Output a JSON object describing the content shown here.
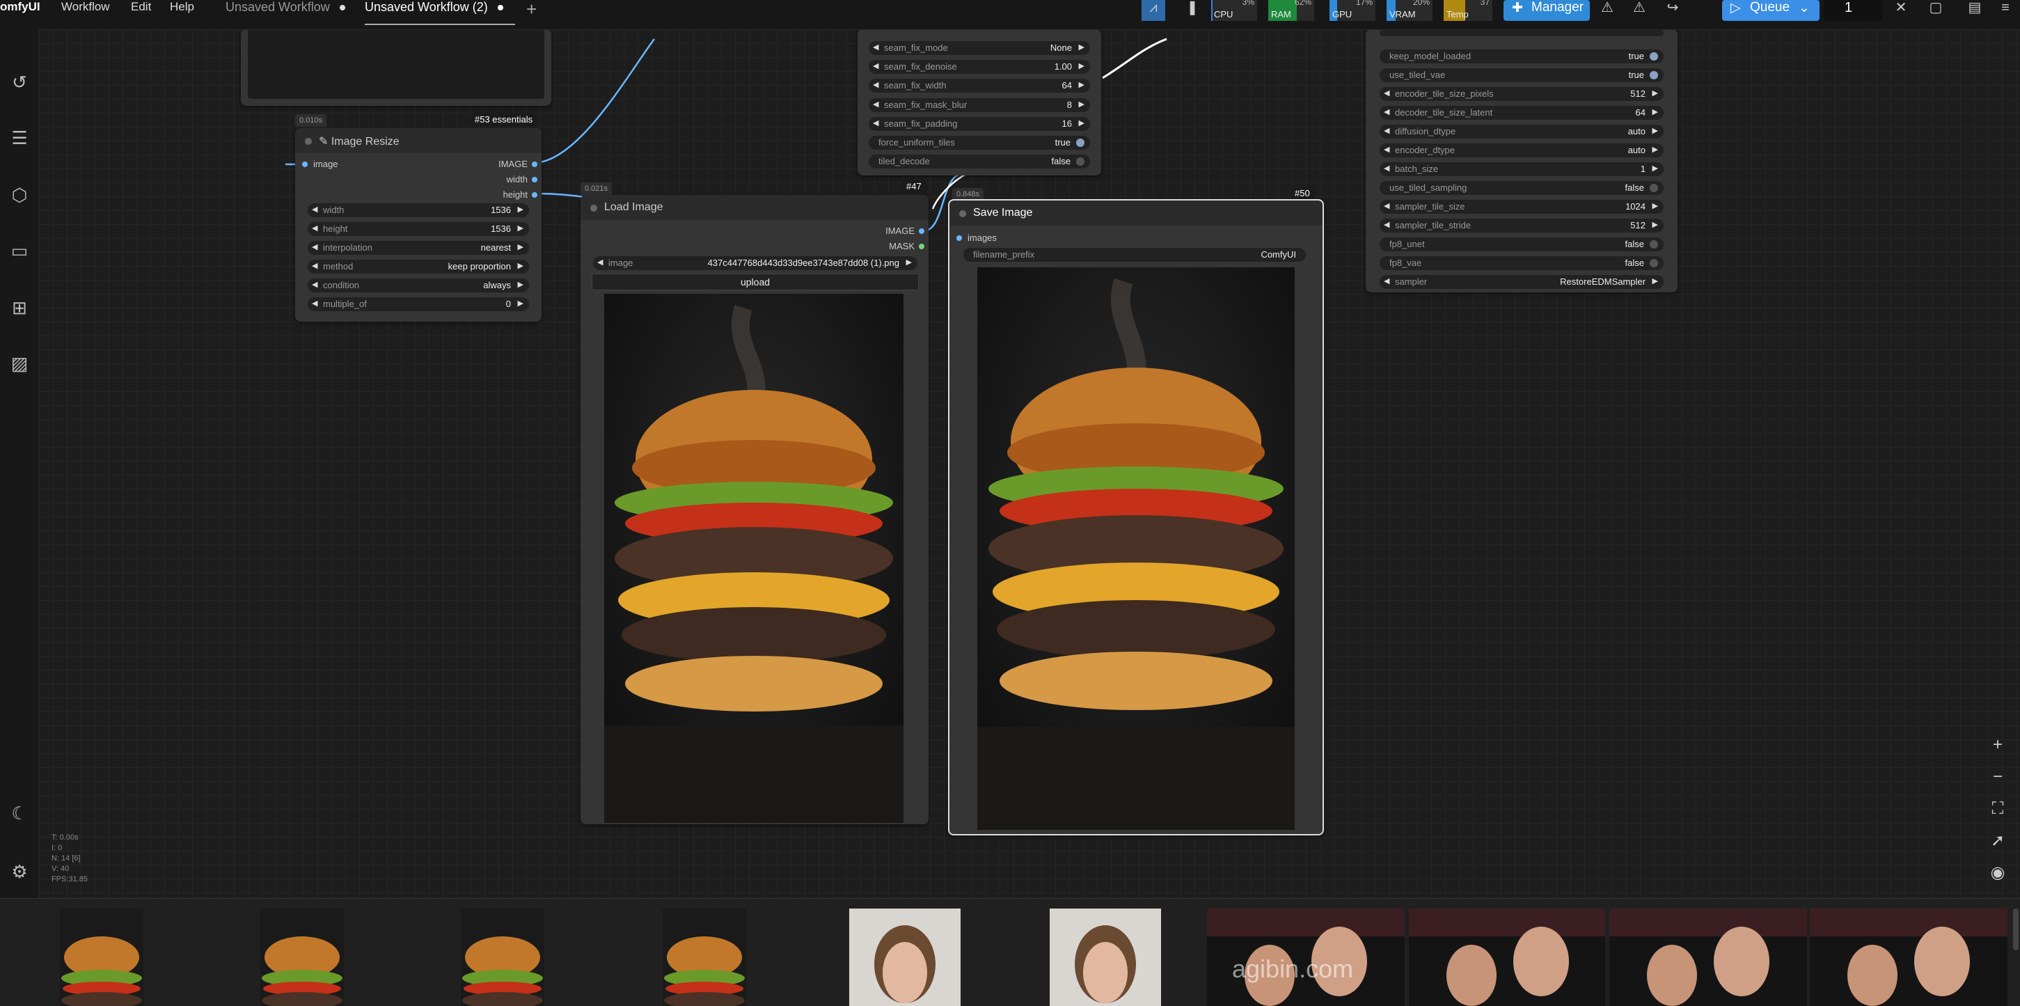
{
  "app": {
    "logo": "omfyUI"
  },
  "menu": [
    "Workflow",
    "Edit",
    "Help"
  ],
  "tabs": [
    {
      "label": "Unsaved Workflow",
      "active": false
    },
    {
      "label": "Unsaved Workflow (2)",
      "active": true
    }
  ],
  "monitor": {
    "cpu": {
      "label": "CPU",
      "value": "3%",
      "color": "#2f8ad8"
    },
    "ram": {
      "label": "RAM",
      "value": "62%",
      "color": "#1e8a3c"
    },
    "gpu": {
      "label": "GPU",
      "value": "17%",
      "color": "#2f8ad8"
    },
    "vram": {
      "label": "VRAM",
      "value": "20%",
      "color": "#2f8ad8"
    },
    "temp": {
      "label": "Temp",
      "value": "37",
      "color": "#b08a10"
    }
  },
  "toolbar": {
    "manager_label": "Manager",
    "queue_label": "Queue",
    "batch_count": "1"
  },
  "nodes": {
    "image_resize": {
      "timing": "0.010s",
      "badge": "#53 essentials",
      "title": "Image Resize",
      "input": "image",
      "outputs": [
        "IMAGE",
        "width",
        "height"
      ],
      "widgets": [
        {
          "label": "width",
          "value": "1536"
        },
        {
          "label": "height",
          "value": "1536"
        },
        {
          "label": "interpolation",
          "value": "nearest"
        },
        {
          "label": "method",
          "value": "keep proportion"
        },
        {
          "label": "condition",
          "value": "always"
        },
        {
          "label": "multiple_of",
          "value": "0"
        }
      ]
    },
    "load_image": {
      "timing": "0.021s",
      "badge": "#47",
      "title": "Load Image",
      "outputs": [
        "IMAGE",
        "MASK"
      ],
      "image_widget": {
        "label": "image",
        "value": "437c447768d443d33d9ee3743e87dd08 (1).png"
      },
      "upload_label": "upload"
    },
    "save_image": {
      "timing": "0.848s",
      "badge": "#50",
      "title": "Save Image",
      "input": "images",
      "prefix": {
        "label": "filename_prefix",
        "value": "ComfyUI"
      }
    },
    "seam_node": {
      "widgets": [
        {
          "label": "seam_fix_mode",
          "value": "None",
          "kind": "combo"
        },
        {
          "label": "seam_fix_denoise",
          "value": "1.00",
          "kind": "combo"
        },
        {
          "label": "seam_fix_width",
          "value": "64",
          "kind": "combo"
        },
        {
          "label": "seam_fix_mask_blur",
          "value": "8",
          "kind": "combo"
        },
        {
          "label": "seam_fix_padding",
          "value": "16",
          "kind": "combo"
        },
        {
          "label": "force_uniform_tiles",
          "value": "true",
          "kind": "toggle"
        },
        {
          "label": "tiled_decode",
          "value": "false",
          "kind": "toggle"
        }
      ]
    },
    "supir_node": {
      "widgets": [
        {
          "label": "keep_model_loaded",
          "value": "true",
          "kind": "toggle"
        },
        {
          "label": "use_tiled_vae",
          "value": "true",
          "kind": "toggle"
        },
        {
          "label": "encoder_tile_size_pixels",
          "value": "512",
          "kind": "combo"
        },
        {
          "label": "decoder_tile_size_latent",
          "value": "64",
          "kind": "combo"
        },
        {
          "label": "diffusion_dtype",
          "value": "auto",
          "kind": "combo"
        },
        {
          "label": "encoder_dtype",
          "value": "auto",
          "kind": "combo"
        },
        {
          "label": "batch_size",
          "value": "1",
          "kind": "combo"
        },
        {
          "label": "use_tiled_sampling",
          "value": "false",
          "kind": "toggle"
        },
        {
          "label": "sampler_tile_size",
          "value": "1024",
          "kind": "combo"
        },
        {
          "label": "sampler_tile_stride",
          "value": "512",
          "kind": "combo"
        },
        {
          "label": "fp8_unet",
          "value": "false",
          "kind": "toggle"
        },
        {
          "label": "fp8_vae",
          "value": "false",
          "kind": "toggle"
        },
        {
          "label": "sampler",
          "value": "RestoreEDMSampler",
          "kind": "combo"
        }
      ]
    }
  },
  "stats": [
    "T: 0.00s",
    "I: 0",
    "N: 14 [6]",
    "V: 40",
    "FPS:31.85"
  ],
  "watermark": "agibin.com"
}
